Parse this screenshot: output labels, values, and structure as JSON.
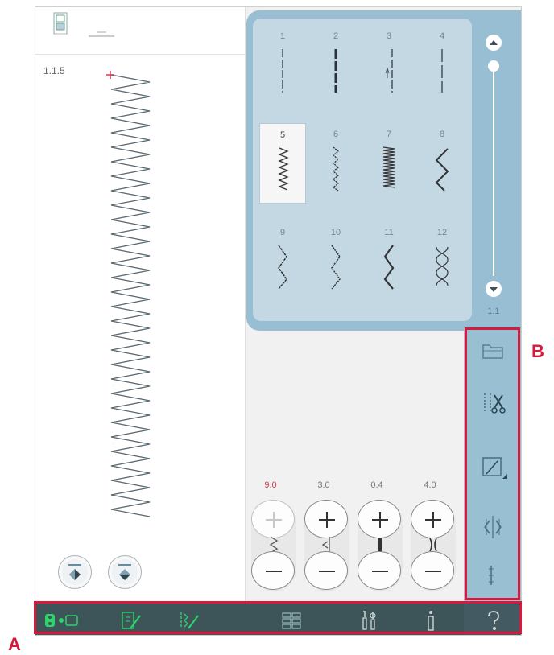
{
  "callouts": {
    "a": "A",
    "b": "B"
  },
  "header": {
    "stitch_id": "1.1.5"
  },
  "stitch_menu": {
    "items": [
      {
        "number": "1"
      },
      {
        "number": "2"
      },
      {
        "number": "3"
      },
      {
        "number": "4"
      },
      {
        "number": "5"
      },
      {
        "number": "6"
      },
      {
        "number": "7"
      },
      {
        "number": "8"
      },
      {
        "number": "9"
      },
      {
        "number": "10"
      },
      {
        "number": "11"
      },
      {
        "number": "12"
      }
    ],
    "selected": "5",
    "page": "1.1"
  },
  "controls": [
    {
      "value": "9.0",
      "color": "#d9394b"
    },
    {
      "value": "3.0",
      "color": "#777777"
    },
    {
      "value": "0.4",
      "color": "#777777"
    },
    {
      "value": "4.0",
      "color": "#777777"
    }
  ],
  "colors": {
    "accent_green": "#2fd36a",
    "menu_blue": "#98bed4",
    "bar_dark": "#3d5458",
    "callout_red": "#d61a3c"
  },
  "icons": {
    "top": [
      "presser-foot-icon",
      "settings-line-icon"
    ],
    "side": [
      "open-folder-icon",
      "thread-cut-icon",
      "tapering-icon",
      "mirror-icon",
      "stitch-info-icon"
    ],
    "bottom": [
      "sewing-mode-icon",
      "stitch-edit-icon",
      "sequence-edit-icon",
      "stitch-menu-icon",
      "tools-icon",
      "info-icon",
      "help-icon"
    ]
  }
}
